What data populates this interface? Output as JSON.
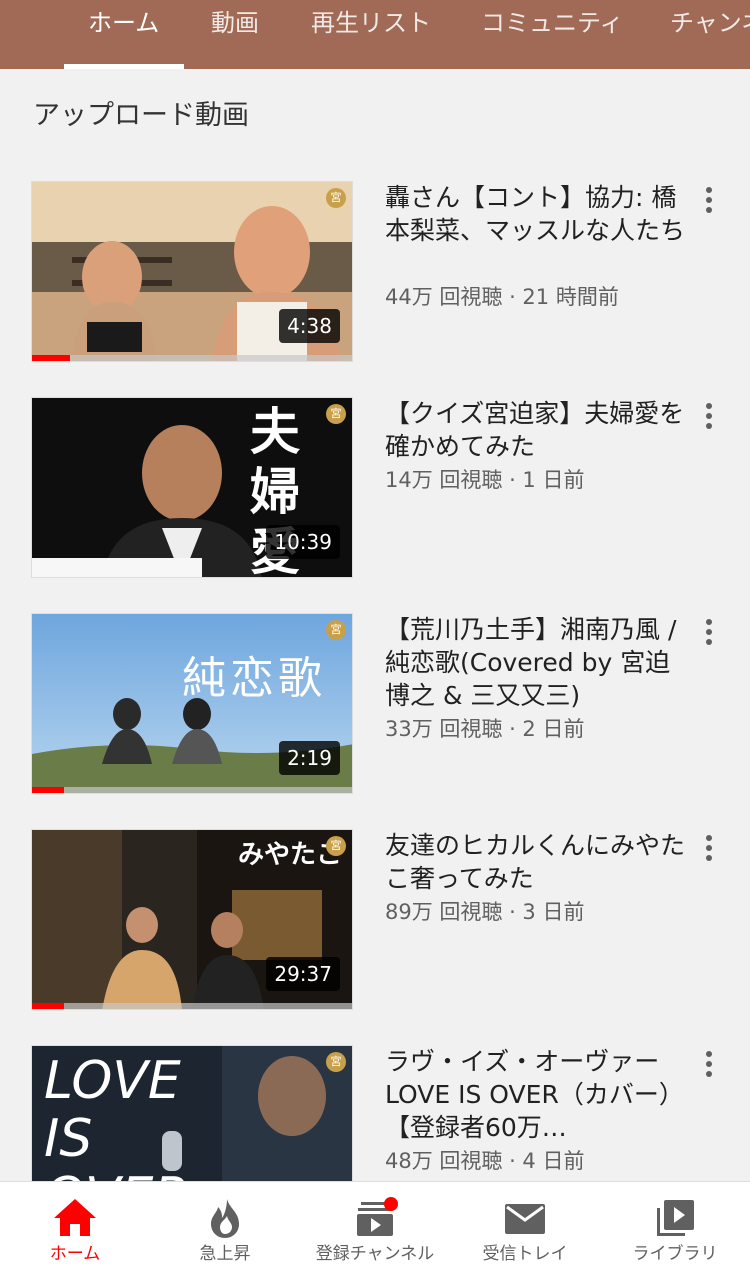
{
  "tabs": [
    {
      "label": "ホーム",
      "active": true
    },
    {
      "label": "動画",
      "active": false
    },
    {
      "label": "再生リスト",
      "active": false
    },
    {
      "label": "コミュニティ",
      "active": false
    },
    {
      "label": "チャンネル",
      "active": false
    }
  ],
  "section_title": "アップロード動画",
  "videos": [
    {
      "title": "轟さん【コント】協力: 橋本梨菜、マッスルな人たち",
      "meta": "44万 回視聴 · 21 時間前",
      "duration": "4:38",
      "progress": 0.12
    },
    {
      "title": "【クイズ宮迫家】夫婦愛を確かめてみた",
      "meta": "14万 回視聴 · 1 日前",
      "duration": "10:39",
      "progress": 0,
      "thumb_text": "夫婦愛"
    },
    {
      "title": "【荒川乃土手】湘南乃風 / 純恋歌(Covered by 宮迫博之 & 三又又三)",
      "meta": "33万 回視聴 · 2 日前",
      "duration": "2:19",
      "progress": 0.1,
      "thumb_text": "純恋歌"
    },
    {
      "title": "友達のヒカルくんにみやたこ奢ってみた",
      "meta": "89万 回視聴 · 3 日前",
      "duration": "29:37",
      "progress": 0.1,
      "thumb_text": "みやたこ"
    },
    {
      "title": "ラヴ・イズ・オーヴァー LOVE IS OVER（カバー）【登録者60万…",
      "meta": "48万 回視聴 · 4 日前",
      "duration": "",
      "progress": 0,
      "thumb_text": "LOVE IS OVER"
    }
  ],
  "bottom_nav": [
    {
      "label": "ホーム",
      "icon": "home-icon",
      "active": true
    },
    {
      "label": "急上昇",
      "icon": "trending-flame-icon",
      "active": false
    },
    {
      "label": "登録チャンネル",
      "icon": "subscriptions-icon",
      "active": false
    },
    {
      "label": "受信トレイ",
      "icon": "inbox-mail-icon",
      "active": false
    },
    {
      "label": "ライブラリ",
      "icon": "library-icon",
      "active": false
    }
  ],
  "seal_label": "宮",
  "colors": {
    "header": "#a06a56",
    "accent": "#ff0000",
    "notification": "#ff0000"
  }
}
